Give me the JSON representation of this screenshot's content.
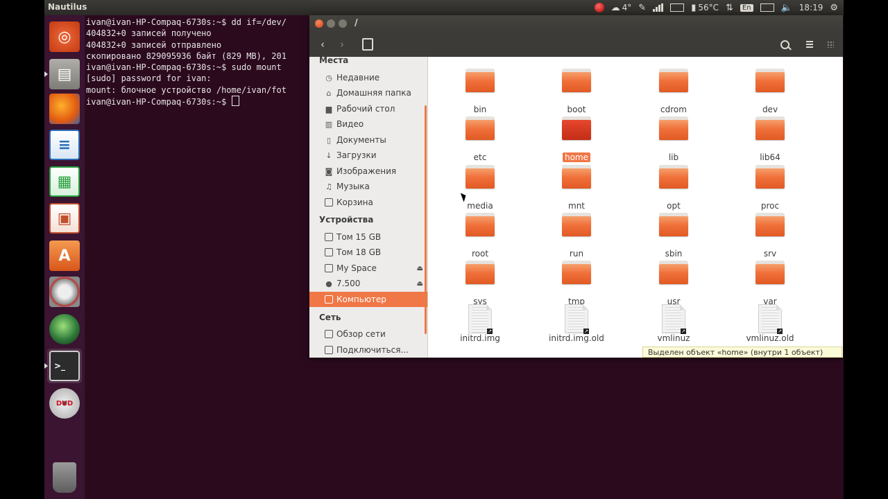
{
  "top_panel": {
    "app_title": "Nautilus",
    "weather": "4°",
    "temperature": "56°C",
    "keyboard": "En",
    "time": "18:19"
  },
  "launcher": {
    "items": [
      {
        "name": "ubuntu-dash-icon",
        "color": "#df4a16"
      },
      {
        "name": "files-icon",
        "color": "#8c8a85"
      },
      {
        "name": "firefox-icon",
        "color": "#e66000"
      },
      {
        "name": "libreoffice-writer-icon",
        "color": "#2a6fb7"
      },
      {
        "name": "libreoffice-calc-icon",
        "color": "#28a03c"
      },
      {
        "name": "libreoffice-impress-icon",
        "color": "#c1502d"
      },
      {
        "name": "software-center-icon",
        "color": "#e8702a"
      },
      {
        "name": "system-settings-icon",
        "color": "#6b6b6b"
      },
      {
        "name": "web-browser-icon",
        "color": "#2f7a3a"
      },
      {
        "name": "terminal-icon",
        "color": "#2c2c2c"
      },
      {
        "name": "dvd-icon",
        "color": "#cfcfcf"
      },
      {
        "name": "trash-icon",
        "color": "#7a7a7a"
      }
    ]
  },
  "terminal": {
    "lines": [
      "ivan@ivan-HP-Compaq-6730s:~$ dd if=/dev/",
      "404832+0 записей получено",
      "404832+0 записей отправлено",
      "скопировано 829095936 байт (829 MB), 201",
      "ivan@ivan-HP-Compaq-6730s:~$ sudo mount ",
      "[sudo] password for ivan:",
      "mount: блочное устройство /home/ivan/fot"
    ],
    "prompt": "ivan@ivan-HP-Compaq-6730s:~$ "
  },
  "window": {
    "title": "/",
    "sidebar": {
      "places_header": "Места",
      "places": [
        "Недавние",
        "Домашняя папка",
        "Рабочий стол",
        "Видео",
        "Документы",
        "Загрузки",
        "Изображения",
        "Музыка",
        "Корзина"
      ],
      "devices_header": "Устройства",
      "devices": [
        "Том 15 GB",
        "Том 18 GB",
        "My Space",
        "7.500",
        "Компьютер"
      ],
      "network_header": "Сеть",
      "network": [
        "Обзор сети",
        "Подключиться..."
      ]
    },
    "folders": [
      "bin",
      "boot",
      "cdrom",
      "dev",
      "etc",
      "home",
      "lib",
      "lib64",
      "media",
      "mnt",
      "opt",
      "proc",
      "root",
      "run",
      "sbin",
      "srv",
      "sys",
      "tmp",
      "usr",
      "var"
    ],
    "files": [
      "initrd.img",
      "initrd.img.old",
      "vmlinuz",
      "vmlinuz.old"
    ],
    "selected": "home",
    "status": "Выделен объект «home» (внутри 1 объект)",
    "accent_color": "#f07746"
  }
}
